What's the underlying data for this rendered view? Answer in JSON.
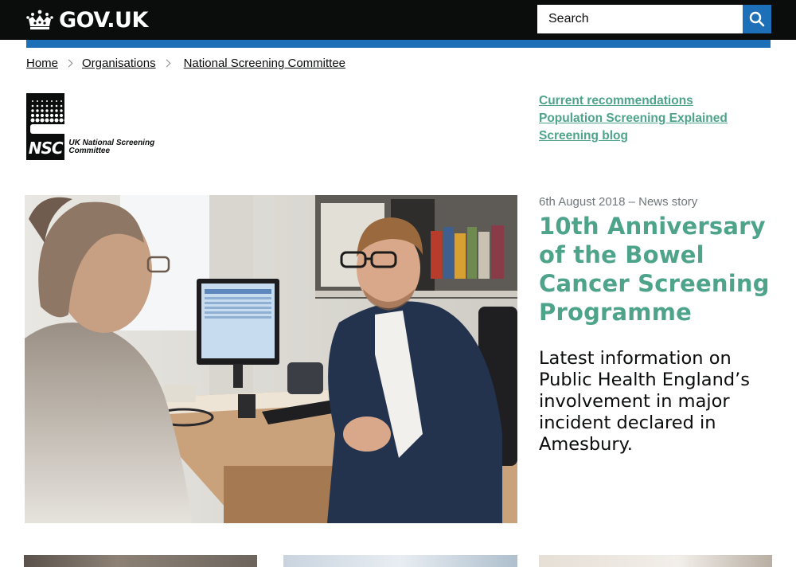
{
  "header": {
    "logo_text": "GOV.UK",
    "search": {
      "placeholder": "Search"
    },
    "accent_bar_color": "#1d70b8"
  },
  "breadcrumbs": [
    {
      "label": "Home"
    },
    {
      "label": "Organisations"
    },
    {
      "label": "National Screening Committee"
    }
  ],
  "organisation": {
    "logo_mark": "NSC",
    "logo_caption": "UK National Screening Committee"
  },
  "side_links": [
    {
      "label": "Current recommendations"
    },
    {
      "label": "Population Screening Explained"
    },
    {
      "label": "Screening blog"
    }
  ],
  "featured": {
    "meta": "6th August 2018 – News story",
    "headline": "10th Anniversary of the Bowel Cancer Screening Programme",
    "summary": "Latest information on Public Health England’s involvement in major incident declared in Amesbury.",
    "link_color": "#4ea38b"
  },
  "icons": {
    "crown": "crown-icon",
    "search": "search-icon",
    "breadcrumb_separator": "chevron-right-icon"
  }
}
